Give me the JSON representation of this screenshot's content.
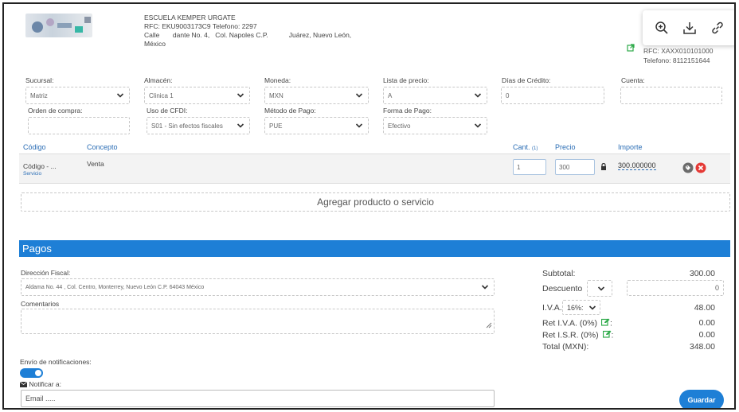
{
  "company": {
    "name": "ESCUELA KEMPER URGATE",
    "rfc_line": "RFC: EKU9003173C9 Telefono: 2297",
    "address_line1": "Calle       dante No. 4,   Col. Napoles C.P.           Juárez, Nuevo León,",
    "address_line2": "México"
  },
  "toolbar": {
    "zoom_icon": "zoom-in-icon",
    "download_icon": "download-icon",
    "link_icon": "link-icon"
  },
  "client": {
    "rfc": "RFC: XAXX010101000",
    "phone": "Telefono: 8112151644"
  },
  "form": {
    "sucursal": {
      "label": "Sucursal:",
      "value": "Matriz"
    },
    "almacen": {
      "label": "Almacén:",
      "value": "Clinica 1"
    },
    "moneda": {
      "label": "Moneda:",
      "value": "MXN"
    },
    "lista_precio": {
      "label": "Lista de precio:",
      "value": "A"
    },
    "dias_credito": {
      "label": "Días de Crédito:",
      "value": "0"
    },
    "cuenta": {
      "label": "Cuenta:",
      "value": ""
    },
    "orden_compra": {
      "label": "Orden de compra:",
      "value": ""
    },
    "uso_cfdi": {
      "label": "Uso de CFDI:",
      "value": "S01 - Sin efectos fiscales"
    },
    "metodo_pago": {
      "label": "Método de Pago:",
      "value": "PUE"
    },
    "forma_pago": {
      "label": "Forma de Pago:",
      "value": "Efectivo"
    }
  },
  "table": {
    "headers": {
      "codigo": "Código",
      "concepto": "Concepto",
      "cant": "Cant.",
      "cant_sup": "(1)",
      "precio": "Precio",
      "importe": "Importe"
    },
    "rows": [
      {
        "codigo": "Código - ...",
        "tipo": "Servicio",
        "concepto": "Venta",
        "cant": "1",
        "precio": "300",
        "importe": "300.000000"
      }
    ]
  },
  "add_button": "Agregar producto o servicio",
  "pagos": {
    "title": "Pagos",
    "direccion_label": "Dirección Fiscal:",
    "direccion_value": "Aldama No. 44 , Col. Centro, Monterrey, Nuevo León C.P. 64043 México",
    "comentarios_label": "Comentarios"
  },
  "summary": {
    "subtotal_label": "Subtotal:",
    "subtotal_value": "300.00",
    "descuento_label": "Descuento",
    "descuento_value": "0",
    "iva_label": "I.V.A.",
    "iva_rate": "16%:",
    "iva_value": "48.00",
    "ret_iva_label": "Ret I.V.A. (0%)",
    "ret_iva_suffix": ":",
    "ret_iva_value": "0.00",
    "ret_isr_label": "Ret I.S.R. (0%)",
    "ret_isr_suffix": ":",
    "ret_isr_value": "0.00",
    "total_label": "Total (MXN):",
    "total_value": "348.00"
  },
  "notifications": {
    "label": "Envío de notificaciones:",
    "notify_label": "Notificar a:",
    "email_placeholder": "Email .....",
    "enabled": true
  },
  "save_button": "Guardar",
  "colors": {
    "accent": "#1e7fd6",
    "link": "#2a6db5",
    "delete": "#e53935",
    "edit_green": "#2eaa4a"
  }
}
